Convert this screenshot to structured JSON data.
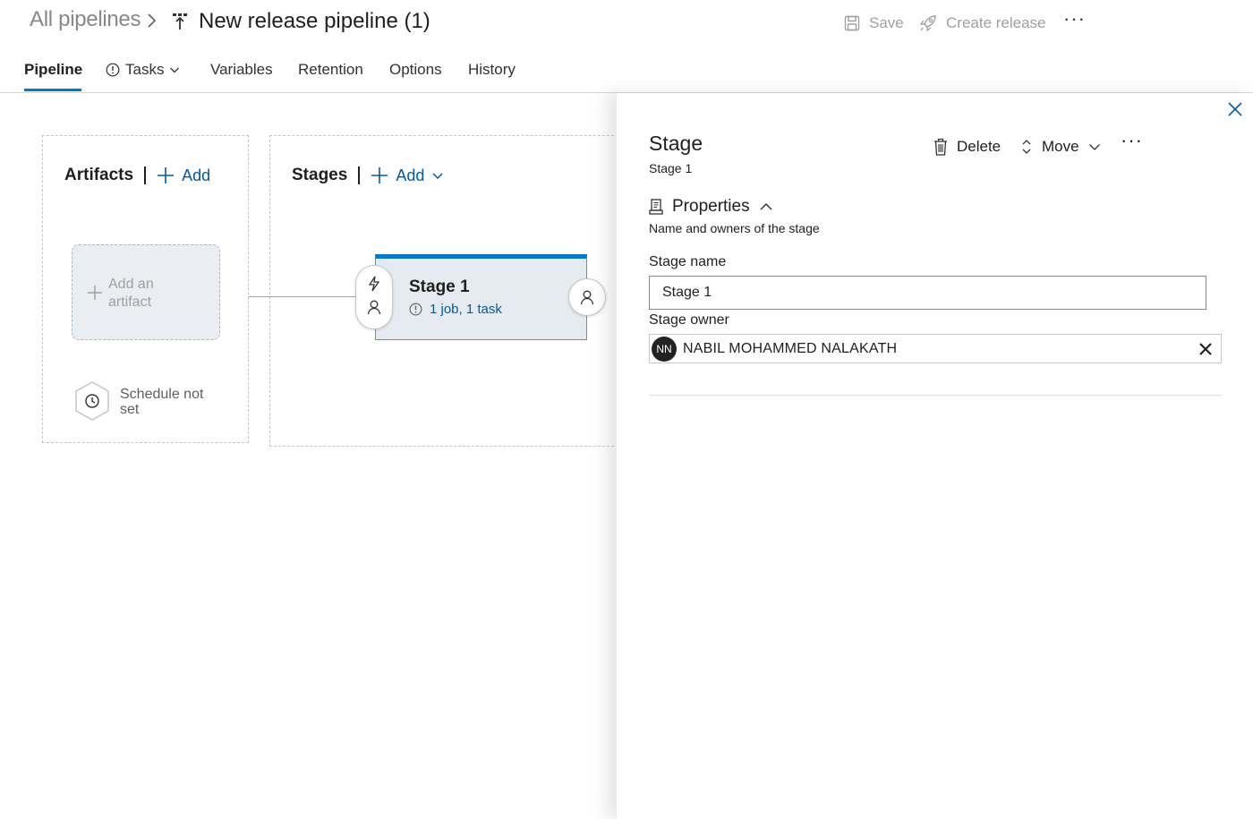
{
  "header": {
    "breadcrumb_all": "All pipelines",
    "pipeline_title": "New release pipeline (1)",
    "save_label": "Save",
    "create_release_label": "Create release",
    "more_label": "···"
  },
  "tabs": {
    "pipeline": "Pipeline",
    "tasks": "Tasks",
    "variables": "Variables",
    "retention": "Retention",
    "options": "Options",
    "history": "History"
  },
  "canvas": {
    "artifacts": {
      "title": "Artifacts",
      "add_label": "Add",
      "add_artifact_text": "Add an artifact",
      "schedule_text": "Schedule not set"
    },
    "stages": {
      "title": "Stages",
      "add_label": "Add",
      "stage_card": {
        "name": "Stage 1",
        "jobs": "1 job",
        "tasks": "1 task"
      }
    }
  },
  "panel": {
    "title": "Stage",
    "subtitle": "Stage 1",
    "delete_label": "Delete",
    "move_label": "Move",
    "more_label": "···",
    "properties": {
      "heading": "Properties",
      "description": "Name and owners of the stage"
    },
    "stage_name_label": "Stage name",
    "stage_name_value": "Stage 1",
    "stage_owner_label": "Stage owner",
    "owner": {
      "initials": "NN",
      "name": "NABIL MOHAMMED NALAKATH"
    }
  },
  "colors": {
    "accent": "#0078d4",
    "link": "#005a9e",
    "disabled_text": "#a19f9d",
    "stage_card_bg": "#e5ebf0"
  }
}
